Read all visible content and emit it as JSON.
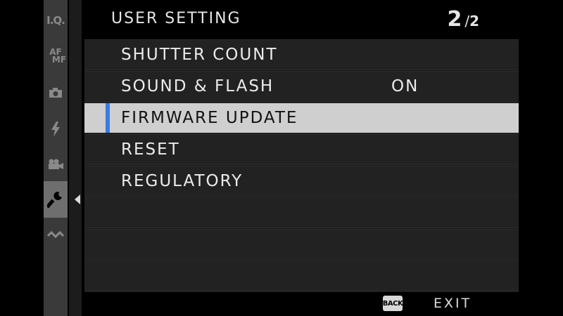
{
  "sidebar": {
    "items": [
      {
        "icon": "image-quality-icon",
        "label": "I.Q."
      },
      {
        "icon": "af-mf-icon",
        "label_top": "AF",
        "label_bottom": "MF"
      },
      {
        "icon": "camera-icon"
      },
      {
        "icon": "flash-icon"
      },
      {
        "icon": "movie-icon"
      },
      {
        "icon": "wrench-icon",
        "active": true
      },
      {
        "icon": "connection-icon"
      }
    ]
  },
  "header": {
    "title": "USER SETTING",
    "page_current": "2",
    "page_separator": "/",
    "page_total": "2"
  },
  "menu": {
    "items": [
      {
        "label": "SHUTTER COUNT",
        "value": ""
      },
      {
        "label": "SOUND & FLASH",
        "value": "ON"
      },
      {
        "label": "FIRMWARE UPDATE",
        "value": "",
        "selected": true
      },
      {
        "label": "RESET",
        "value": ""
      },
      {
        "label": "REGULATORY",
        "value": ""
      },
      {
        "label": "",
        "value": ""
      },
      {
        "label": "",
        "value": ""
      },
      {
        "label": "",
        "value": ""
      }
    ]
  },
  "footer": {
    "back_key": "BACK",
    "exit_label": "EXIT"
  },
  "colors": {
    "selection_marker": "#3b7be0",
    "selected_row": "#cfcfcf"
  }
}
